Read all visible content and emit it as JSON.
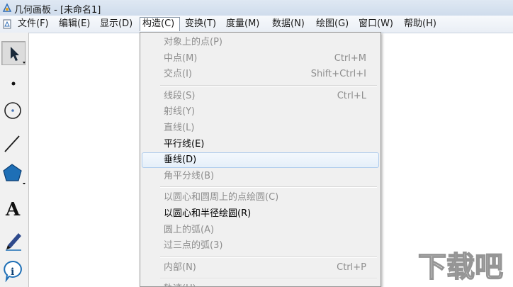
{
  "window": {
    "title": "几何画板 - [未命名1]"
  },
  "menubar": {
    "items": [
      {
        "label": "文件(F)",
        "name": "menu-file"
      },
      {
        "label": "编辑(E)",
        "name": "menu-edit"
      },
      {
        "label": "显示(D)",
        "name": "menu-display"
      },
      {
        "label": "构造(C)",
        "name": "menu-construct",
        "open": true
      },
      {
        "label": "变换(T)",
        "name": "menu-transform"
      },
      {
        "label": "度量(M)",
        "name": "menu-measure"
      },
      {
        "label": "数据(N)",
        "name": "menu-number"
      },
      {
        "label": "绘图(G)",
        "name": "menu-graph"
      },
      {
        "label": "窗口(W)",
        "name": "menu-window"
      },
      {
        "label": "帮助(H)",
        "name": "menu-help"
      }
    ]
  },
  "toolbar": {
    "tools": [
      {
        "name": "arrow-select-tool",
        "icon": "arrow-icon",
        "selected": true
      },
      {
        "name": "point-tool",
        "icon": "point-icon"
      },
      {
        "name": "compass-tool",
        "icon": "circle-icon"
      },
      {
        "name": "straightedge-tool",
        "icon": "line-icon"
      },
      {
        "name": "polygon-tool",
        "icon": "pentagon-icon"
      },
      {
        "name": "text-tool",
        "icon": "text-a-icon"
      },
      {
        "name": "marker-tool",
        "icon": "pen-icon"
      },
      {
        "name": "information-tool",
        "icon": "info-icon"
      }
    ]
  },
  "construct_menu": {
    "items": [
      {
        "label": "对象上的点(P)",
        "shortcut": "",
        "enabled": false
      },
      {
        "label": "中点(M)",
        "shortcut": "Ctrl+M",
        "enabled": false
      },
      {
        "label": "交点(I)",
        "shortcut": "Shift+Ctrl+I",
        "enabled": false
      },
      {
        "separator": true
      },
      {
        "label": "线段(S)",
        "shortcut": "Ctrl+L",
        "enabled": false
      },
      {
        "label": "射线(Y)",
        "shortcut": "",
        "enabled": false
      },
      {
        "label": "直线(L)",
        "shortcut": "",
        "enabled": false
      },
      {
        "label": "平行线(E)",
        "shortcut": "",
        "enabled": true
      },
      {
        "label": "垂线(D)",
        "shortcut": "",
        "enabled": true,
        "hover": true
      },
      {
        "label": "角平分线(B)",
        "shortcut": "",
        "enabled": false
      },
      {
        "separator": true
      },
      {
        "label": "以圆心和圆周上的点绘圆(C)",
        "shortcut": "",
        "enabled": false
      },
      {
        "label": "以圆心和半径绘圆(R)",
        "shortcut": "",
        "enabled": true
      },
      {
        "label": "圆上的弧(A)",
        "shortcut": "",
        "enabled": false
      },
      {
        "label": "过三点的弧(3)",
        "shortcut": "",
        "enabled": false
      },
      {
        "separator": true
      },
      {
        "label": "内部(N)",
        "shortcut": "Ctrl+P",
        "enabled": false
      },
      {
        "separator": true
      },
      {
        "label": "轨迹(U)",
        "shortcut": "",
        "enabled": false
      }
    ]
  },
  "watermark": {
    "text": "下载吧"
  },
  "colors": {
    "highlight_border": "#aecbec",
    "disabled_text": "#8e8e8e",
    "polygon_fill": "#1e6fb6"
  }
}
